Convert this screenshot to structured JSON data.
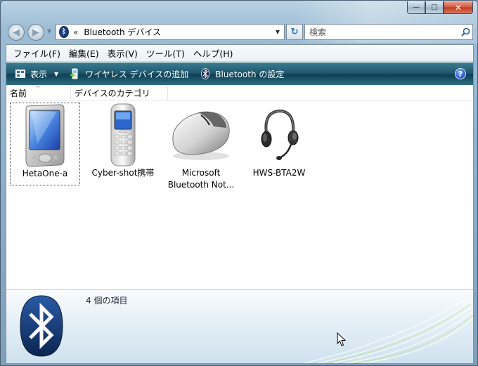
{
  "window": {
    "caption_buttons": {
      "minimize": "—",
      "maximize": "□",
      "close": "✕"
    }
  },
  "navigation": {
    "back_glyph": "◀",
    "forward_glyph": "▶",
    "address": {
      "chevron": "«",
      "location": "Bluetooth デバイス"
    },
    "refresh_glyph": "↻",
    "search": {
      "placeholder": "検索"
    }
  },
  "menu": [
    "ファイル(F)",
    "編集(E)",
    "表示(V)",
    "ツール(T)",
    "ヘルプ(H)"
  ],
  "toolbar": {
    "view_label": "表示",
    "add_device_label": "ワイヤレス デバイスの追加",
    "bt_settings_label": "Bluetooth の設定",
    "help_glyph": "?"
  },
  "columns": [
    "名前",
    "デバイスのカテゴリ"
  ],
  "devices": [
    {
      "label": "HetaOne-a",
      "icon": "pda-icon",
      "selected": true
    },
    {
      "label": "Cyber-shot携帯",
      "icon": "mobile-phone-icon",
      "selected": false
    },
    {
      "label_line1": "Microsoft",
      "label_line2": "Bluetooth Not...",
      "icon": "mouse-icon",
      "selected": false
    },
    {
      "label": "HWS-BTA2W",
      "icon": "headset-icon",
      "selected": false
    }
  ],
  "details": {
    "item_count": "4 個の項目"
  },
  "colors": {
    "toolbar_accent": "#22596f",
    "bluetooth_blue": "#163c78",
    "frame": "#8fb2cc"
  }
}
